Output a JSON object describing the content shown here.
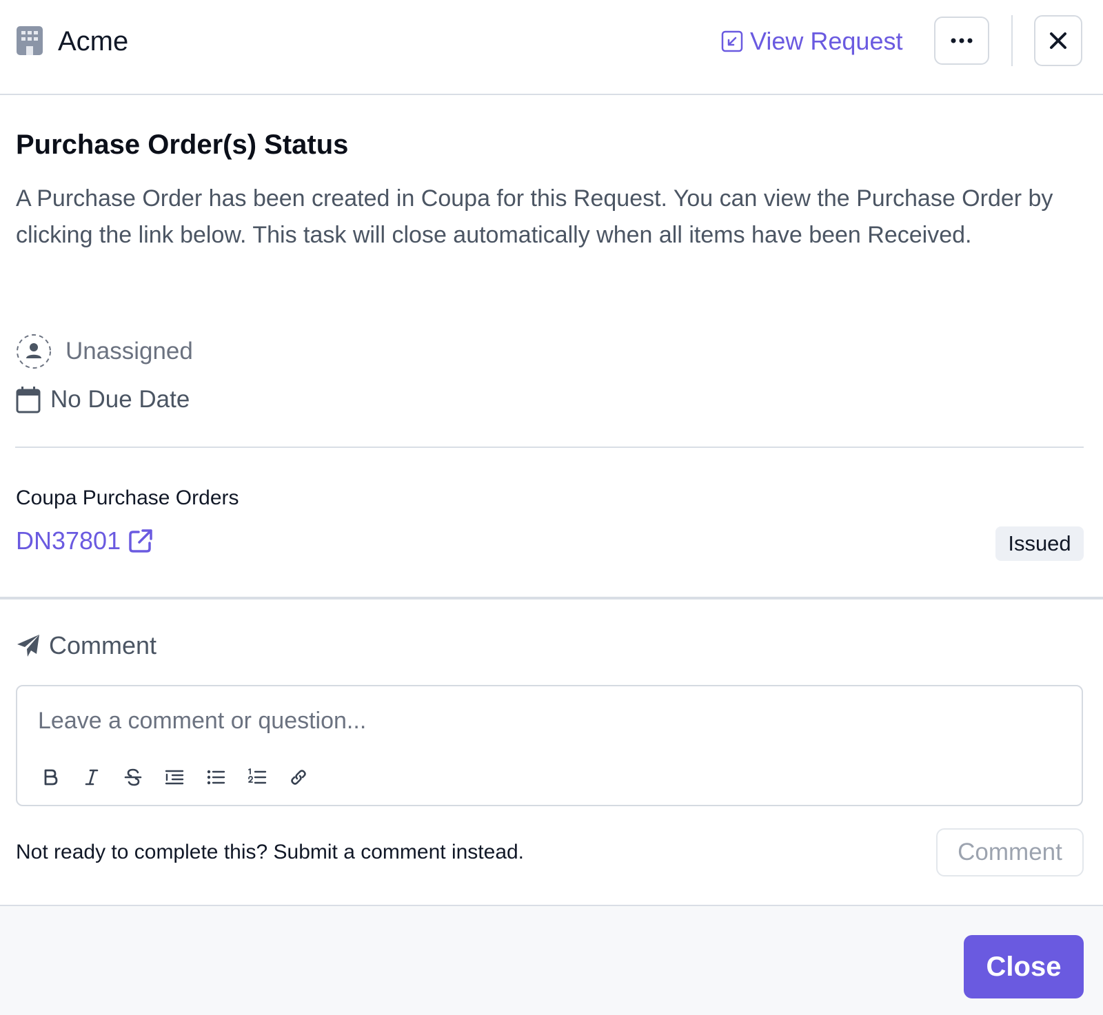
{
  "header": {
    "org_name": "Acme",
    "org_icon": "building-icon",
    "view_request_label": "View Request",
    "more_icon": "ellipsis-icon",
    "close_icon": "close-icon"
  },
  "task": {
    "title": "Purchase Order(s) Status",
    "description": "A Purchase Order has been created in Coupa for this Request. You can view the Purchase Order by clicking the link below. This task will close automatically when all items have been Received.",
    "assignee": "Unassigned",
    "due_date": "No Due Date"
  },
  "purchase_orders": {
    "heading": "Coupa Purchase Orders",
    "items": [
      {
        "id": "DN37801",
        "status": "Issued"
      }
    ]
  },
  "comment": {
    "heading": "Comment",
    "placeholder": "Leave a comment or question...",
    "toolbar": [
      "bold",
      "italic",
      "strikethrough",
      "indent",
      "bullet-list",
      "numbered-list",
      "link"
    ],
    "hint": "Not ready to complete this? Submit a comment instead.",
    "submit_label": "Comment"
  },
  "footer": {
    "close_label": "Close"
  },
  "colors": {
    "accent": "#6a5ae0",
    "badge_bg": "#edf0f5",
    "border": "#d9dee5"
  }
}
